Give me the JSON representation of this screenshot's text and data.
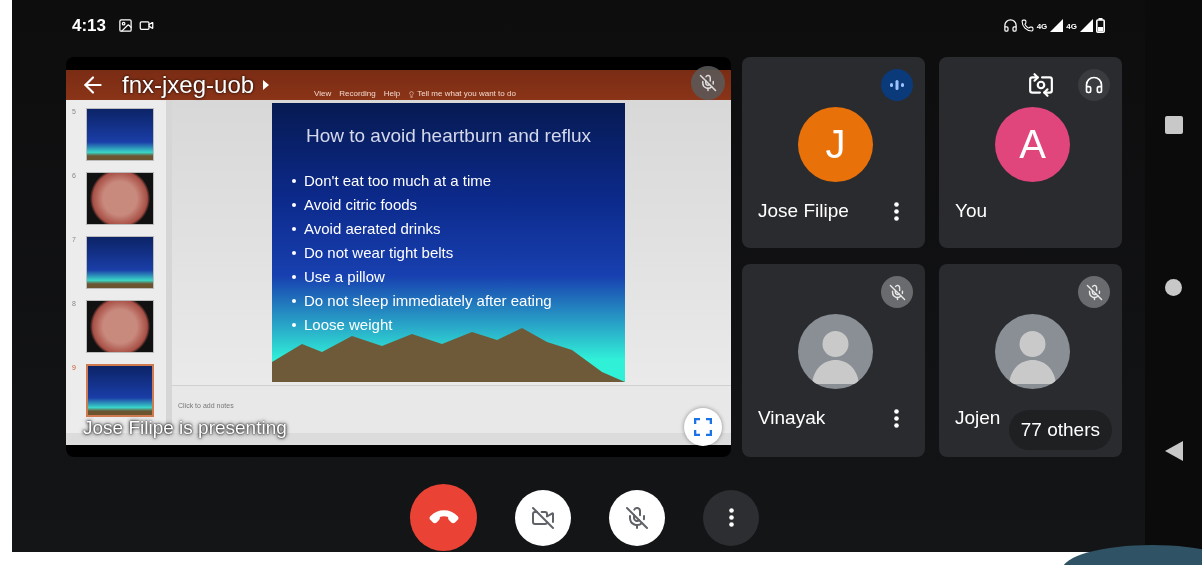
{
  "status_bar": {
    "time": "4:13",
    "network_labels": [
      "4G",
      "4G"
    ]
  },
  "presentation": {
    "meeting_code": "fnx-jxeg-uob",
    "presenter_label": "Jose Filipe is presenting",
    "host_muted": true,
    "app": {
      "ribbon_tabs": [
        "View",
        "Recording",
        "Help"
      ],
      "search_hint": "Tell me what you want to do",
      "notes_placeholder": "Click to add notes",
      "thumbnails": [
        {
          "number": "5",
          "kind": "slide",
          "selected": false
        },
        {
          "number": "6",
          "kind": "photo",
          "selected": false
        },
        {
          "number": "7",
          "kind": "slide",
          "selected": false
        },
        {
          "number": "8",
          "kind": "photo",
          "selected": false
        },
        {
          "number": "9",
          "kind": "slide",
          "selected": true
        }
      ],
      "slide": {
        "title": "How to avoid heartburn and reflux",
        "bullets": [
          "Don't eat too much at a time",
          "Avoid citric foods",
          "Avoid aerated drinks",
          "Do not wear tight belts",
          "Use a pillow",
          "Do not sleep immediately after eating",
          "Loose weight"
        ]
      }
    }
  },
  "participants": [
    {
      "name": "Jose Filipe",
      "kind": "remote",
      "avatar": {
        "kind": "letter",
        "letter": "J",
        "color": "#e8710a"
      },
      "muted": false,
      "speaking": true
    },
    {
      "name": "You",
      "kind": "self",
      "avatar": {
        "kind": "letter",
        "letter": "A",
        "color": "#e0457b"
      },
      "muted": false,
      "speaking": false
    },
    {
      "name": "Vinayak",
      "kind": "remote",
      "avatar": {
        "kind": "photo"
      },
      "muted": true,
      "speaking": false
    },
    {
      "name": "Jojen",
      "kind": "overflow",
      "avatar": {
        "kind": "photo"
      },
      "muted": true,
      "speaking": false,
      "others": "77 others"
    }
  ],
  "controls": [
    {
      "kind": "hangup"
    },
    {
      "kind": "camera",
      "on": false
    },
    {
      "kind": "mic",
      "on": false
    },
    {
      "kind": "more"
    }
  ]
}
